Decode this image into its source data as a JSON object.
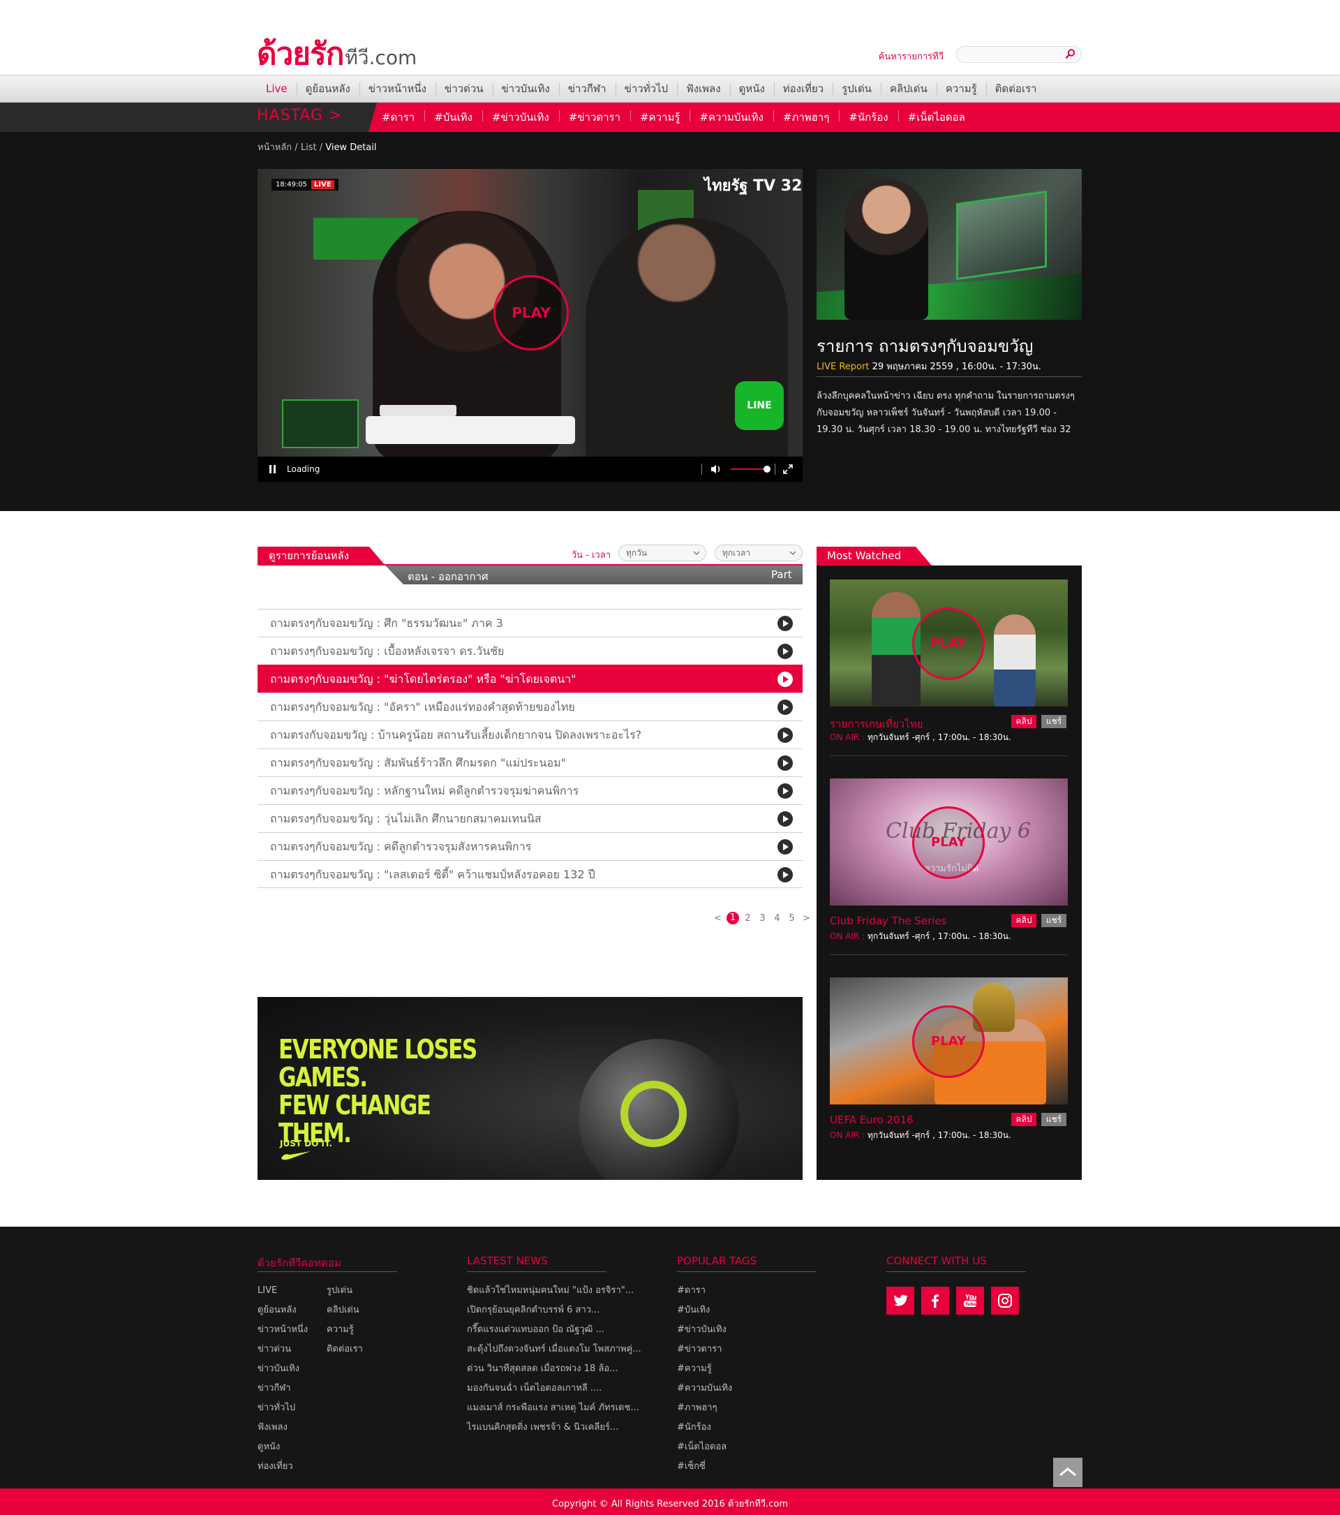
{
  "brand": {
    "logo_main": "ด้วยรัก",
    "logo_sub": "ทีวี.com",
    "accent": "#e8003d"
  },
  "search": {
    "label": "ค้นหารายการทีวี",
    "placeholder": ""
  },
  "nav": {
    "items": [
      "Live",
      "ดูย้อนหลัง",
      "ข่าวหน้าหนึ่ง",
      "ข่าวด่วน",
      "ข่าวบันเทิง",
      "ข่าวกีฬา",
      "ข่าวทั่วไป",
      "ฟังเพลง",
      "ดูหนัง",
      "ท่องเที่ยว",
      "รูปเด่น",
      "คลิปเด่น",
      "ความรู้",
      "ติดต่อเรา"
    ],
    "active": "Live"
  },
  "hashtags": {
    "label": "HASTAG >",
    "items": [
      "#ดารา",
      "#บันเทิง",
      "#ข่าวบันเทิง",
      "#ข่าวดารา",
      "#ความรู้",
      "#ความบันเทิง",
      "#ภาพฮาๆ",
      "#นักร้อง",
      "#เน็ตไอดอล"
    ]
  },
  "breadcrumb": {
    "home": "หน้าหลัก",
    "sep": " / ",
    "list": "List",
    "current": "View Detail"
  },
  "player": {
    "play_label": "PLAY",
    "loading": "Loading",
    "live_time": "18:49:05",
    "live_badge": "LIVE",
    "channel": "ไทยรัฐ TV 32",
    "line_badge": "LINE",
    "volume_level": 0.9
  },
  "feature": {
    "title": "รายการ ถามตรงๆกับจอมขวัญ",
    "live_label": "LIVE Report",
    "datetime": "29 พฤษภาคม 2559 , 16:00น. - 17:30น.",
    "description": "ล้วงลึกบุคคลในหน้าข่าว เฉียบ ตรง ทุกคำถาม ในรายการถามตรงๆกับจอมขวัญ หลาวเพ็ชร์ วันจันทร์ - วันพฤหัสบดี เวลา 19.00 - 19.30 น. วันศุกร์ เวลา 18.30 - 19.00 น. ทางไทยรัฐทีวี ช่อง 32"
  },
  "replay": {
    "tab_label": "ดูรายการย้อนหลัง",
    "filter_label": "วัน - เวลา",
    "day_select": "ทุกวัน",
    "time_select": "ทุกเวลา",
    "col_episode": "ตอน - ออกอากาศ",
    "col_part": "Part",
    "episodes": [
      "ถามตรงๆกับจอมขวัญ : ศึก \"ธรรมวัฒนะ\" ภาค 3",
      "ถามตรงๆกับจอมขวัญ : เบื้องหลังเจรจา ดร.วันชัย",
      "ถามตรงๆกับจอมขวัญ : \"ฆ่าโดยไตร่ตรอง\" หรือ \"ฆ่าโดยเจตนา\"",
      "ถามตรงๆกับจอมขวัญ : \"อัครา\" เหมืองแร่ทองคำสุดท้ายของไทย",
      "ถามตรงกับจอมขวัญ : บ้านครูน้อย สถานรับเลี้ยงเด็กยากจน ปิดลงเพราะอะไร?",
      "ถามตรงๆกับจอมขวัญ : สัมพันธ์ร้าวลึก ศึกมรดก \"แม่ประนอม\"",
      "ถามตรงๆกับจอมขวัญ : หลักฐานใหม่ คดีลูกตำรวจรุมฆ่าคนพิการ",
      "ถามตรงๆกับจอมขวัญ : วุ่นไม่เลิก ศึกนายกสมาคมเทนนิส",
      "ถามตรงๆกับจอมขวัญ : คดีลูกตำรวจรุมสังหารคนพิการ",
      "ถามตรงๆกับจอมขวัญ : \"เลสเตอร์ ซิตี้\" คว้าแชมป์หลังรอคอย 132 ปี"
    ],
    "active_index": 2,
    "pagination": {
      "prev": "<",
      "pages": [
        "1",
        "2",
        "3",
        "4",
        "5"
      ],
      "current": "1",
      "next": ">"
    }
  },
  "ad": {
    "headline_1": "EVERYONE LOSES GAMES.",
    "headline_2": "FEW CHANGE THEM.",
    "slogan": "JUST DO IT."
  },
  "most_watched": {
    "tab_label": "Most Watched",
    "play_label": "PLAY",
    "clip_label": "คลิป",
    "share_label": "แชร์",
    "onair_label": "ON AIR :",
    "items": [
      {
        "title": "รายการเกษเที่ยวไทย",
        "schedule": "ทุกวันจันทร์ -ศุกร์ , 17:00น. - 18:30น."
      },
      {
        "title": "Club Friday The Series",
        "schedule": "ทุกวันจันทร์ -ศุกร์ , 17:00น. - 18:30น.",
        "thumb_text_1": "Club Friday 6",
        "thumb_text_2": "ความรักไม่ผิด"
      },
      {
        "title": "UEFA Euro 2016",
        "schedule": "ทุกวันจันทร์ -ศุกร์ , 17:00น. - 18:30น."
      }
    ]
  },
  "footer": {
    "site": {
      "heading": "ด้วยรักทีวีดอทคอม",
      "col1": [
        "LIVE",
        "ดูย้อนหลัง",
        "ข่าวหน้าหนึ่ง",
        "ข่าวด่วน",
        "ข่าวบันเทิง",
        "ข่าวกีฬา",
        "ข่าวทั่วไป",
        "ฟังเพลง",
        "ดูหนัง",
        "ท่องเที่ยว"
      ],
      "col2": [
        "รูปเด่น",
        "คลิปเด่น",
        "ความรู้",
        "ติดต่อเรา"
      ]
    },
    "news": {
      "heading": "LASTEST NEWS",
      "items": [
        "ชิดแล้วใช่ไหมหนุ่มคนใหม่ \"แป้ง อรจิรา\"...",
        "เปิดกรุย้อนยุคลิกดำบรรพ์ 6 สาว...",
        "กรี๊ดแรงแต่วแทบออก ป้อ ณัฐวุฒิ ...",
        "สะดุ้งไปถึงดวงจันทร์ เมื่อแตงโม โพสภาพคู่...",
        "ด่วน วินาทีสุดสลด เมื่อรถพ่วง 18 ล้อ...",
        "มองกันจนฉ่ำ เน็ตไอดอลเกาหลี ....",
        "แมงเมาส์ กระพือแรง สาเหตุ ไมค์ ภัทรเดช...",
        "ไรแบนคิกสุดติ่ง เพชรจ้า & นิวเคลียร์..."
      ]
    },
    "tags": {
      "heading": "POPULAR TAGS",
      "items": [
        "#ดารา",
        "#บันเทิง",
        "#ข่าวบันเทิง",
        "#ข่าวดารา",
        "#ความรู้",
        "#ความบันเทิง",
        "#ภาพฮาๆ",
        "#นักร้อง",
        "#เน็ตไอดอล",
        "#เซ็กซี่"
      ]
    },
    "social": {
      "heading": "CONNECT WITH US",
      "icons": [
        "twitter-icon",
        "facebook-icon",
        "youtube-icon",
        "instagram-icon"
      ]
    },
    "copyright": "Copyright © All Rights Reserved 2016 ด้วยรักทีวี.com"
  }
}
